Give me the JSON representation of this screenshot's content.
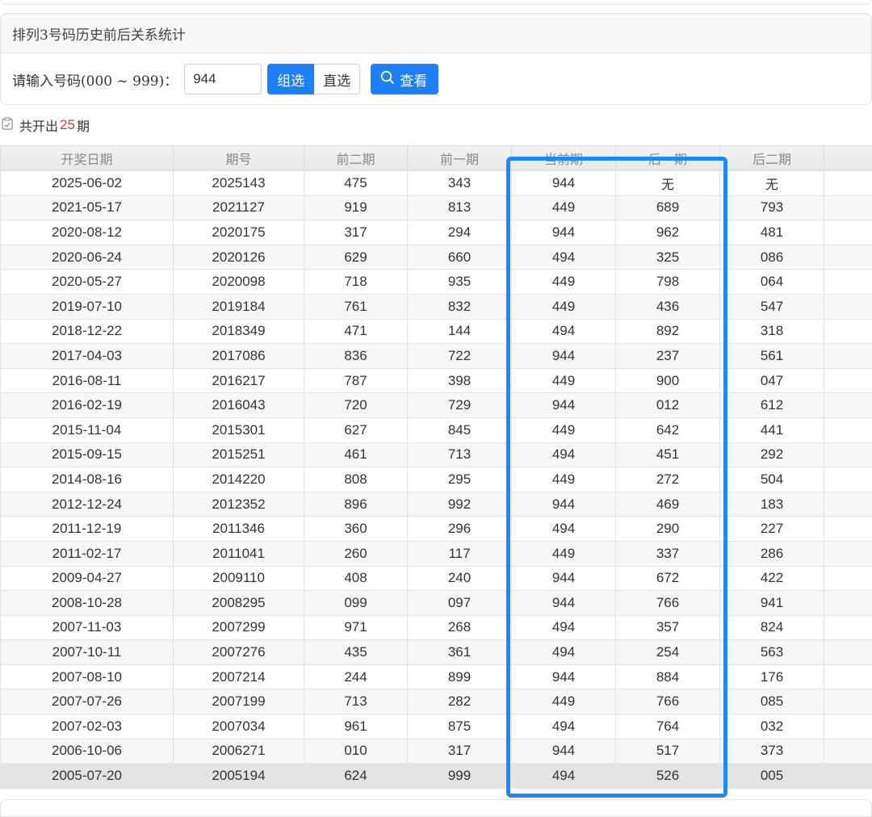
{
  "panel": {
    "title": "排列3号码历史前后关系统计",
    "input_label": "请输入号码(000 ~ 999)：",
    "input_value": "944",
    "mode_group": "组选",
    "mode_direct": "直选",
    "query_label": "查看"
  },
  "summary": {
    "prefix": "共开出",
    "count": "25",
    "suffix": "期"
  },
  "table": {
    "headers": [
      "开奖日期",
      "期号",
      "前二期",
      "前一期",
      "当前期",
      "后一期",
      "后二期"
    ],
    "rows": [
      [
        "2025-06-02",
        "2025143",
        "475",
        "343",
        "944",
        "无",
        "无"
      ],
      [
        "2021-05-17",
        "2021127",
        "919",
        "813",
        "449",
        "689",
        "793"
      ],
      [
        "2020-08-12",
        "2020175",
        "317",
        "294",
        "944",
        "962",
        "481"
      ],
      [
        "2020-06-24",
        "2020126",
        "629",
        "660",
        "494",
        "325",
        "086"
      ],
      [
        "2020-05-27",
        "2020098",
        "718",
        "935",
        "449",
        "798",
        "064"
      ],
      [
        "2019-07-10",
        "2019184",
        "761",
        "832",
        "449",
        "436",
        "547"
      ],
      [
        "2018-12-22",
        "2018349",
        "471",
        "144",
        "494",
        "892",
        "318"
      ],
      [
        "2017-04-03",
        "2017086",
        "836",
        "722",
        "944",
        "237",
        "561"
      ],
      [
        "2016-08-11",
        "2016217",
        "787",
        "398",
        "449",
        "900",
        "047"
      ],
      [
        "2016-02-19",
        "2016043",
        "720",
        "729",
        "944",
        "012",
        "612"
      ],
      [
        "2015-11-04",
        "2015301",
        "627",
        "845",
        "449",
        "642",
        "441"
      ],
      [
        "2015-09-15",
        "2015251",
        "461",
        "713",
        "494",
        "451",
        "292"
      ],
      [
        "2014-08-16",
        "2014220",
        "808",
        "295",
        "449",
        "272",
        "504"
      ],
      [
        "2012-12-24",
        "2012352",
        "896",
        "992",
        "944",
        "469",
        "183"
      ],
      [
        "2011-12-19",
        "2011346",
        "360",
        "296",
        "494",
        "290",
        "227"
      ],
      [
        "2011-02-17",
        "2011041",
        "260",
        "117",
        "449",
        "337",
        "286"
      ],
      [
        "2009-04-27",
        "2009110",
        "408",
        "240",
        "944",
        "672",
        "422"
      ],
      [
        "2008-10-28",
        "2008295",
        "099",
        "097",
        "944",
        "766",
        "941"
      ],
      [
        "2007-11-03",
        "2007299",
        "971",
        "268",
        "494",
        "357",
        "824"
      ],
      [
        "2007-10-11",
        "2007276",
        "435",
        "361",
        "494",
        "254",
        "563"
      ],
      [
        "2007-08-10",
        "2007214",
        "244",
        "899",
        "944",
        "884",
        "176"
      ],
      [
        "2007-07-26",
        "2007199",
        "713",
        "282",
        "449",
        "766",
        "085"
      ],
      [
        "2007-02-03",
        "2007034",
        "961",
        "875",
        "494",
        "764",
        "032"
      ],
      [
        "2006-10-06",
        "2006271",
        "010",
        "317",
        "944",
        "517",
        "373"
      ],
      [
        "2005-07-20",
        "2005194",
        "624",
        "999",
        "494",
        "526",
        "005"
      ]
    ]
  },
  "colors": {
    "accent": "#1e7ff6",
    "highlight_border": "#1f87f6",
    "count_red": "#d9342b"
  },
  "icons": {
    "query": "search-icon",
    "summary": "clipboard-check-icon"
  }
}
